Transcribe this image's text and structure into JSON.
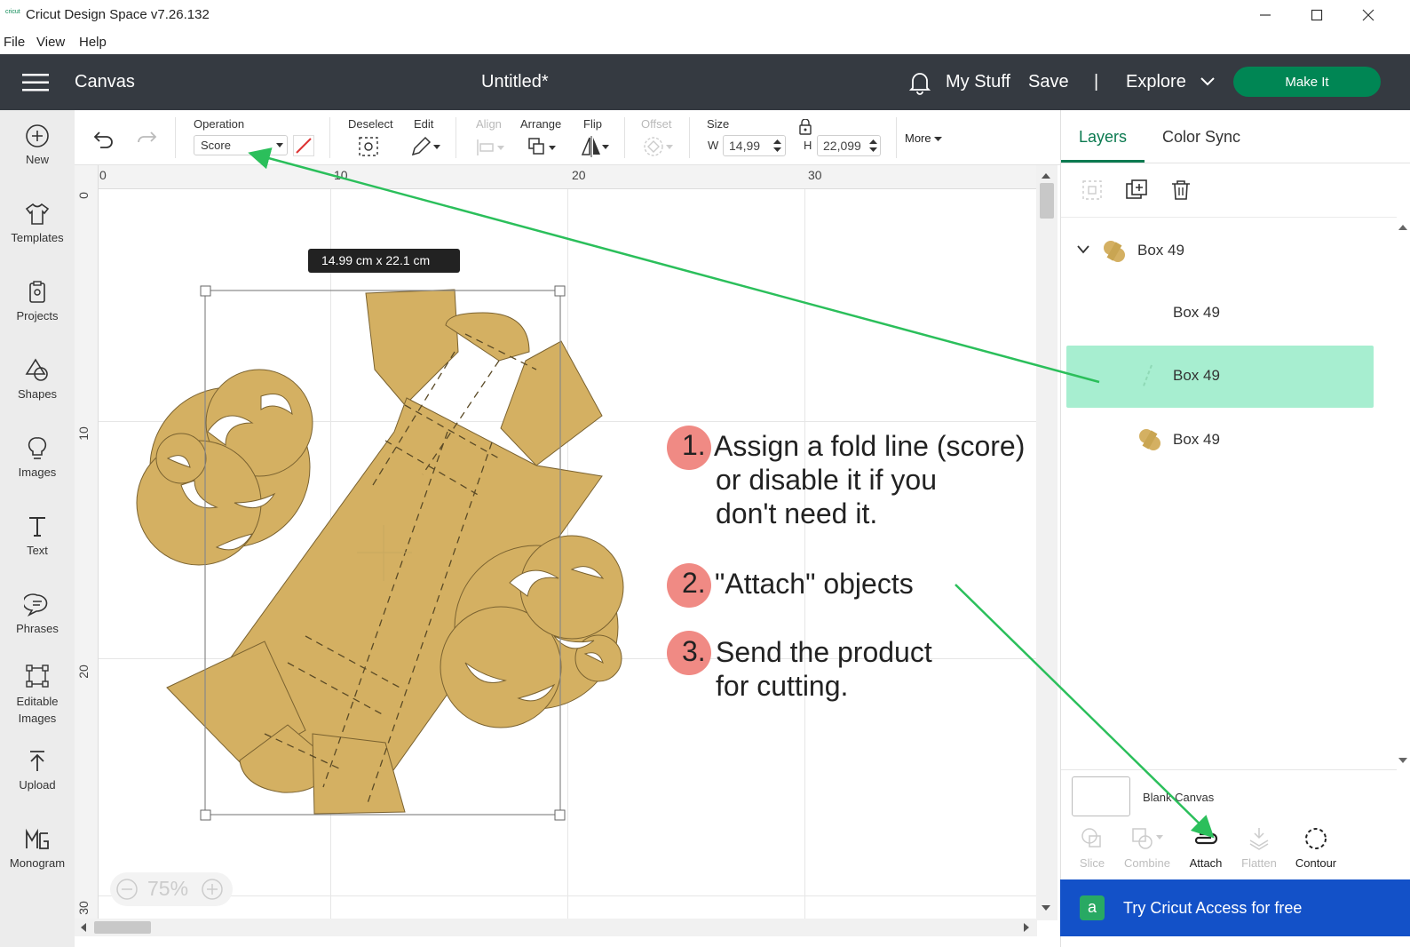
{
  "window": {
    "logo_text": "cricut",
    "title": "Cricut Design Space  v7.26.132"
  },
  "menu": [
    "File",
    "View",
    "Help"
  ],
  "header": {
    "section": "Canvas",
    "doc_title": "Untitled*",
    "my_stuff": "My Stuff",
    "save": "Save",
    "divider": "|",
    "explore": "Explore",
    "make_it": "Make It"
  },
  "sidebar": {
    "items": [
      {
        "label": "New",
        "icon": "plus-circle-icon"
      },
      {
        "label": "Templates",
        "icon": "tshirt-icon"
      },
      {
        "label": "Projects",
        "icon": "projects-icon"
      },
      {
        "label": "Shapes",
        "icon": "shapes-icon"
      },
      {
        "label": "Images",
        "icon": "lightbulb-icon"
      },
      {
        "label": "Text",
        "icon": "text-icon"
      },
      {
        "label": "Phrases",
        "icon": "speech-bubble-icon"
      },
      {
        "label": "Editable Images",
        "icon": "editable-image-icon"
      },
      {
        "label": "Upload",
        "icon": "upload-icon"
      },
      {
        "label": "Monogram",
        "icon": "monogram-icon"
      }
    ]
  },
  "toolbar": {
    "operation_label": "Operation",
    "operation_value": "Score",
    "deselect_label": "Deselect",
    "edit_label": "Edit",
    "align_label": "Align",
    "arrange_label": "Arrange",
    "flip_label": "Flip",
    "offset_label": "Offset",
    "size_label": "Size",
    "w_label": "W",
    "w_value": "14,99",
    "h_label": "H",
    "h_value": "22,099",
    "more_label": "More"
  },
  "canvas": {
    "ruler_top": [
      "0",
      "10",
      "20",
      "30"
    ],
    "ruler_left": [
      "0",
      "10",
      "20",
      "30"
    ],
    "size_tooltip": "14.99  cm x 22.1  cm",
    "zoom": "75%"
  },
  "annotations": [
    {
      "number": "1.",
      "lines": [
        "Assign a fold line (score)",
        "or disable it if you",
        "don't need it."
      ]
    },
    {
      "number": "2.",
      "lines": [
        "\"Attach\" objects"
      ]
    },
    {
      "number": "3.",
      "lines": [
        "Send the product",
        "for cutting."
      ]
    }
  ],
  "right_panel": {
    "tabs": [
      "Layers",
      "Color Sync"
    ],
    "active_tab": "Layers",
    "layers": [
      {
        "name": "Box 49",
        "level": 0,
        "expanded": true
      },
      {
        "name": "Box 49",
        "level": 1
      },
      {
        "name": "Box 49",
        "level": 1,
        "selected": true
      },
      {
        "name": "Box 49",
        "level": 1
      }
    ],
    "blank_canvas": "Blank Canvas",
    "tools": [
      {
        "label": "Slice",
        "enabled": false
      },
      {
        "label": "Combine",
        "enabled": false
      },
      {
        "label": "Attach",
        "enabled": true
      },
      {
        "label": "Flatten",
        "enabled": false
      },
      {
        "label": "Contour",
        "enabled": true
      }
    ],
    "access_banner": "Try Cricut Access for free"
  },
  "colors": {
    "header_bg": "#353a41",
    "make_it": "#008654",
    "layers_accent": "#0b7a50",
    "selected_layer": "#a7eed0",
    "material": "#d4b062",
    "annotation_arrow": "#2bbf5b",
    "number_circle": "#f08a84",
    "access_banner": "#1351c8"
  }
}
